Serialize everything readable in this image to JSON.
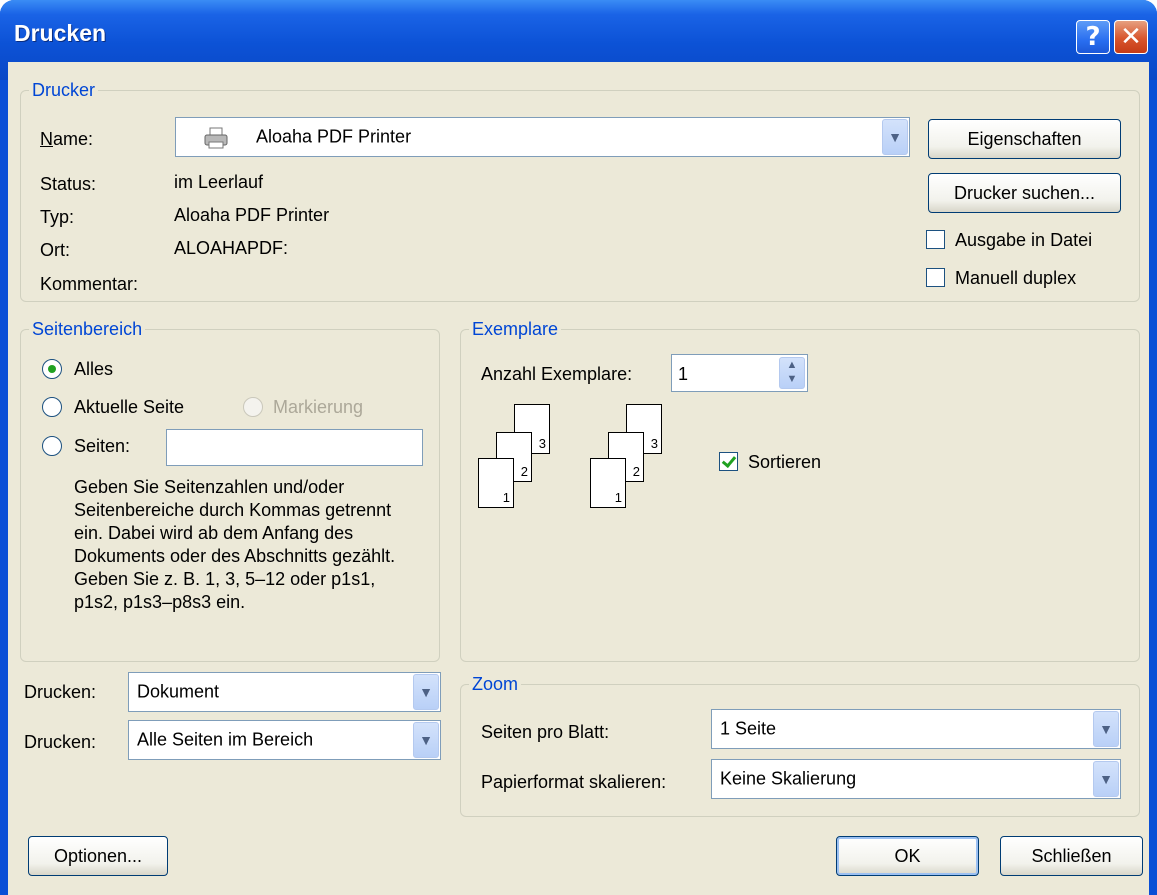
{
  "window": {
    "title": "Drucken"
  },
  "printer": {
    "group_title": "Drucker",
    "name_label": "Name:",
    "name_value": "Aloaha PDF Printer",
    "status_label": "Status:",
    "status_value": "im Leerlauf",
    "type_label": "Typ:",
    "type_value": "Aloaha PDF Printer",
    "location_label": "Ort:",
    "location_value": "ALOAHAPDF:",
    "comment_label": "Kommentar:",
    "properties_button": "Eigenschaften",
    "find_printer_button": "Drucker suchen...",
    "print_to_file_label": "Ausgabe in Datei",
    "print_to_file_checked": false,
    "manual_duplex_label": "Manuell duplex",
    "manual_duplex_checked": false
  },
  "page_range": {
    "group_title": "Seitenbereich",
    "all_label": "Alles",
    "current_page_label": "Aktuelle Seite",
    "selection_label": "Markierung",
    "pages_label": "Seiten:",
    "pages_value": "",
    "selected": "Alles",
    "help_text": "Geben Sie Seitenzahlen und/oder Seitenbereiche durch Kommas getrennt ein. Dabei wird ab dem Anfang des Dokuments oder des Abschnitts gezählt. Geben Sie z. B. 1, 3, 5–12 oder p1s1, p1s2, p1s3–p8s3 ein."
  },
  "copies": {
    "group_title": "Exemplare",
    "count_label": "Anzahl Exemplare:",
    "count_value": "1",
    "collate_label": "Sortieren",
    "collate_checked": true,
    "page_numbers": [
      "3",
      "2",
      "1"
    ]
  },
  "print_what": {
    "label1": "Drucken:",
    "value1": "Dokument",
    "label2": "Drucken:",
    "value2": "Alle Seiten im Bereich"
  },
  "zoom": {
    "group_title": "Zoom",
    "pages_per_sheet_label": "Seiten pro Blatt:",
    "pages_per_sheet_value": "1 Seite",
    "scale_label": "Papierformat skalieren:",
    "scale_value": "Keine Skalierung"
  },
  "buttons": {
    "options": "Optionen...",
    "ok": "OK",
    "close": "Schließen"
  }
}
